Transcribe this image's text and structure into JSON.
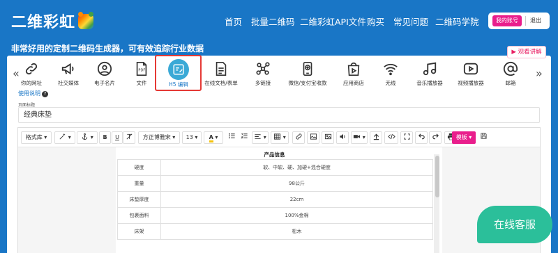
{
  "header": {
    "logo": "二维彩虹",
    "nav": [
      "首页",
      "批量二维码",
      "二维彩虹API文件",
      "购买",
      "常见问题",
      "二维码学院"
    ],
    "account_label": "我的账号",
    "logout_label": "退出"
  },
  "tagline": "非常好用的定制二维码生成器，可有效追踪行业数据",
  "view_demo_label": "▶ 观看讲解",
  "types": [
    {
      "label": "你的网址",
      "icon": "link-icon"
    },
    {
      "label": "社交媒体",
      "icon": "megaphone-icon"
    },
    {
      "label": "电子名片",
      "icon": "person-icon"
    },
    {
      "label": "文件",
      "icon": "pdf-file-icon"
    },
    {
      "label": "H5 编辑",
      "icon": "h5-edit-icon"
    },
    {
      "label": "在线文档/表单",
      "icon": "document-icon"
    },
    {
      "label": "多链接",
      "icon": "network-icon"
    },
    {
      "label": "微信/支付宝收款",
      "icon": "payment-icon"
    },
    {
      "label": "应用商店",
      "icon": "app-store-icon"
    },
    {
      "label": "无线",
      "icon": "wifi-icon"
    },
    {
      "label": "音乐播放器",
      "icon": "music-icon"
    },
    {
      "label": "视频播放器",
      "icon": "video-icon"
    },
    {
      "label": "邮箱",
      "icon": "at-icon"
    }
  ],
  "active_type_index": 4,
  "help_label": "使用说明",
  "page_title_label": "页面标题",
  "page_title_value": "经典床垫",
  "toolbar": {
    "format_label": "格式库",
    "font_label": "方正博雅宋",
    "size_label": "13",
    "template_label": "模板"
  },
  "document": {
    "title": "产品信息",
    "rows": [
      {
        "key": "硬度",
        "value": "软、中软、硬、加硬+混合硬度"
      },
      {
        "key": "重量",
        "value": "98公斤"
      },
      {
        "key": "床垫厚度",
        "value": "22cm"
      },
      {
        "key": "包裹面料",
        "value": "100%金棉"
      },
      {
        "key": "床架",
        "value": "松木"
      }
    ]
  },
  "chat_label": "在线客服",
  "colors": {
    "brand_blue": "#1976c6",
    "accent_pink": "#e91e8c",
    "highlight_red": "#e53935",
    "chat_green": "#2bbf9a"
  }
}
